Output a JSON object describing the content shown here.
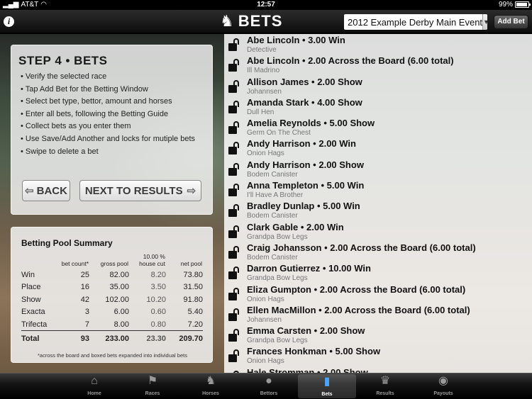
{
  "status_bar": {
    "carrier": "AT&T",
    "time": "12:57",
    "battery": "99%"
  },
  "navbar": {
    "title": "BETS",
    "event_selected": "2012 Example Derby Main Event",
    "add_bet_label": "Add Bet"
  },
  "step": {
    "title": "STEP 4 • BETS",
    "items": [
      "Verify the selected race",
      "Tap Add Bet for the Betting Window",
      "Select bet type, bettor, amount and horses",
      "Enter all bets, following the Betting Guide",
      "Collect bets as you enter them",
      "Use Save/Add Another and locks for mutiple bets",
      "Swipe to delete a bet"
    ],
    "back_label": "BACK",
    "next_label": "NEXT TO RESULTS"
  },
  "pool": {
    "title": "Betting Pool Summary",
    "house_cut_pct": "10.00 %",
    "headers": [
      "bet count*",
      "gross pool",
      "house cut",
      "net pool"
    ],
    "rows": [
      {
        "type": "Win",
        "count": "25",
        "gross": "82.00",
        "cut": "8.20",
        "net": "73.80"
      },
      {
        "type": "Place",
        "count": "16",
        "gross": "35.00",
        "cut": "3.50",
        "net": "31.50"
      },
      {
        "type": "Show",
        "count": "42",
        "gross": "102.00",
        "cut": "10.20",
        "net": "91.80"
      },
      {
        "type": "Exacta",
        "count": "3",
        "gross": "6.00",
        "cut": "0.60",
        "net": "5.40"
      },
      {
        "type": "Trifecta",
        "count": "7",
        "gross": "8.00",
        "cut": "0.80",
        "net": "7.20"
      }
    ],
    "total": {
      "type": "Total",
      "count": "93",
      "gross": "233.00",
      "cut": "23.30",
      "net": "209.70"
    },
    "note": "*across the board and boxed bets expanded into individual bets"
  },
  "bets": [
    {
      "main": "Abe Lincoln • 3.00 Win",
      "sub": "Detective"
    },
    {
      "main": "Abe Lincoln • 2.00 Across the Board (6.00 total)",
      "sub": "Ill Madrino"
    },
    {
      "main": "Allison James • 2.00 Show",
      "sub": "Johannsen"
    },
    {
      "main": "Amanda Stark • 4.00 Show",
      "sub": "Dull Hen"
    },
    {
      "main": "Amelia Reynolds • 5.00 Show",
      "sub": "Germ On The Chest"
    },
    {
      "main": "Andy Harrison • 2.00 Win",
      "sub": "Onion Hags"
    },
    {
      "main": "Andy Harrison • 2.00 Show",
      "sub": "Bodem Canister"
    },
    {
      "main": "Anna Templeton • 5.00 Win",
      "sub": "I'll Have A Brother"
    },
    {
      "main": "Bradley Dunlap • 5.00 Win",
      "sub": "Bodem Canister"
    },
    {
      "main": "Clark Gable • 2.00 Win",
      "sub": "Grandpa Bow Legs"
    },
    {
      "main": "Craig Johansson • 2.00 Across the Board (6.00 total)",
      "sub": "Bodem Canister"
    },
    {
      "main": "Darron Gutierrez • 10.00 Win",
      "sub": "Grandpa Bow Legs"
    },
    {
      "main": "Eliza Gumpton • 2.00 Across the Board (6.00 total)",
      "sub": "Onion Hags"
    },
    {
      "main": "Ellen MacMillon • 2.00 Across the Board (6.00 total)",
      "sub": "Johannsen"
    },
    {
      "main": "Emma Carsten • 2.00 Show",
      "sub": "Grandpa Bow Legs"
    },
    {
      "main": "Frances Honkman • 5.00 Show",
      "sub": "Onion Hags"
    },
    {
      "main": "Hale Stromman • 2.00 Show",
      "sub": ""
    }
  ],
  "tabs": [
    {
      "label": "Home",
      "icon": "home-icon",
      "glyph": "⌂"
    },
    {
      "label": "Races",
      "icon": "flag-icon",
      "glyph": "⚑"
    },
    {
      "label": "Horses",
      "icon": "horse-icon",
      "glyph": "♞"
    },
    {
      "label": "Bettors",
      "icon": "person-icon",
      "glyph": "●"
    },
    {
      "label": "Bets",
      "icon": "ticket-icon",
      "glyph": "▮"
    },
    {
      "label": "Results",
      "icon": "trophy-icon",
      "glyph": "♛"
    },
    {
      "label": "Payouts",
      "icon": "money-bag-icon",
      "glyph": "◉"
    }
  ],
  "active_tab": "Bets",
  "colors": {
    "accent_blue": "#4aa3ff",
    "tab_bar": "#141414"
  }
}
